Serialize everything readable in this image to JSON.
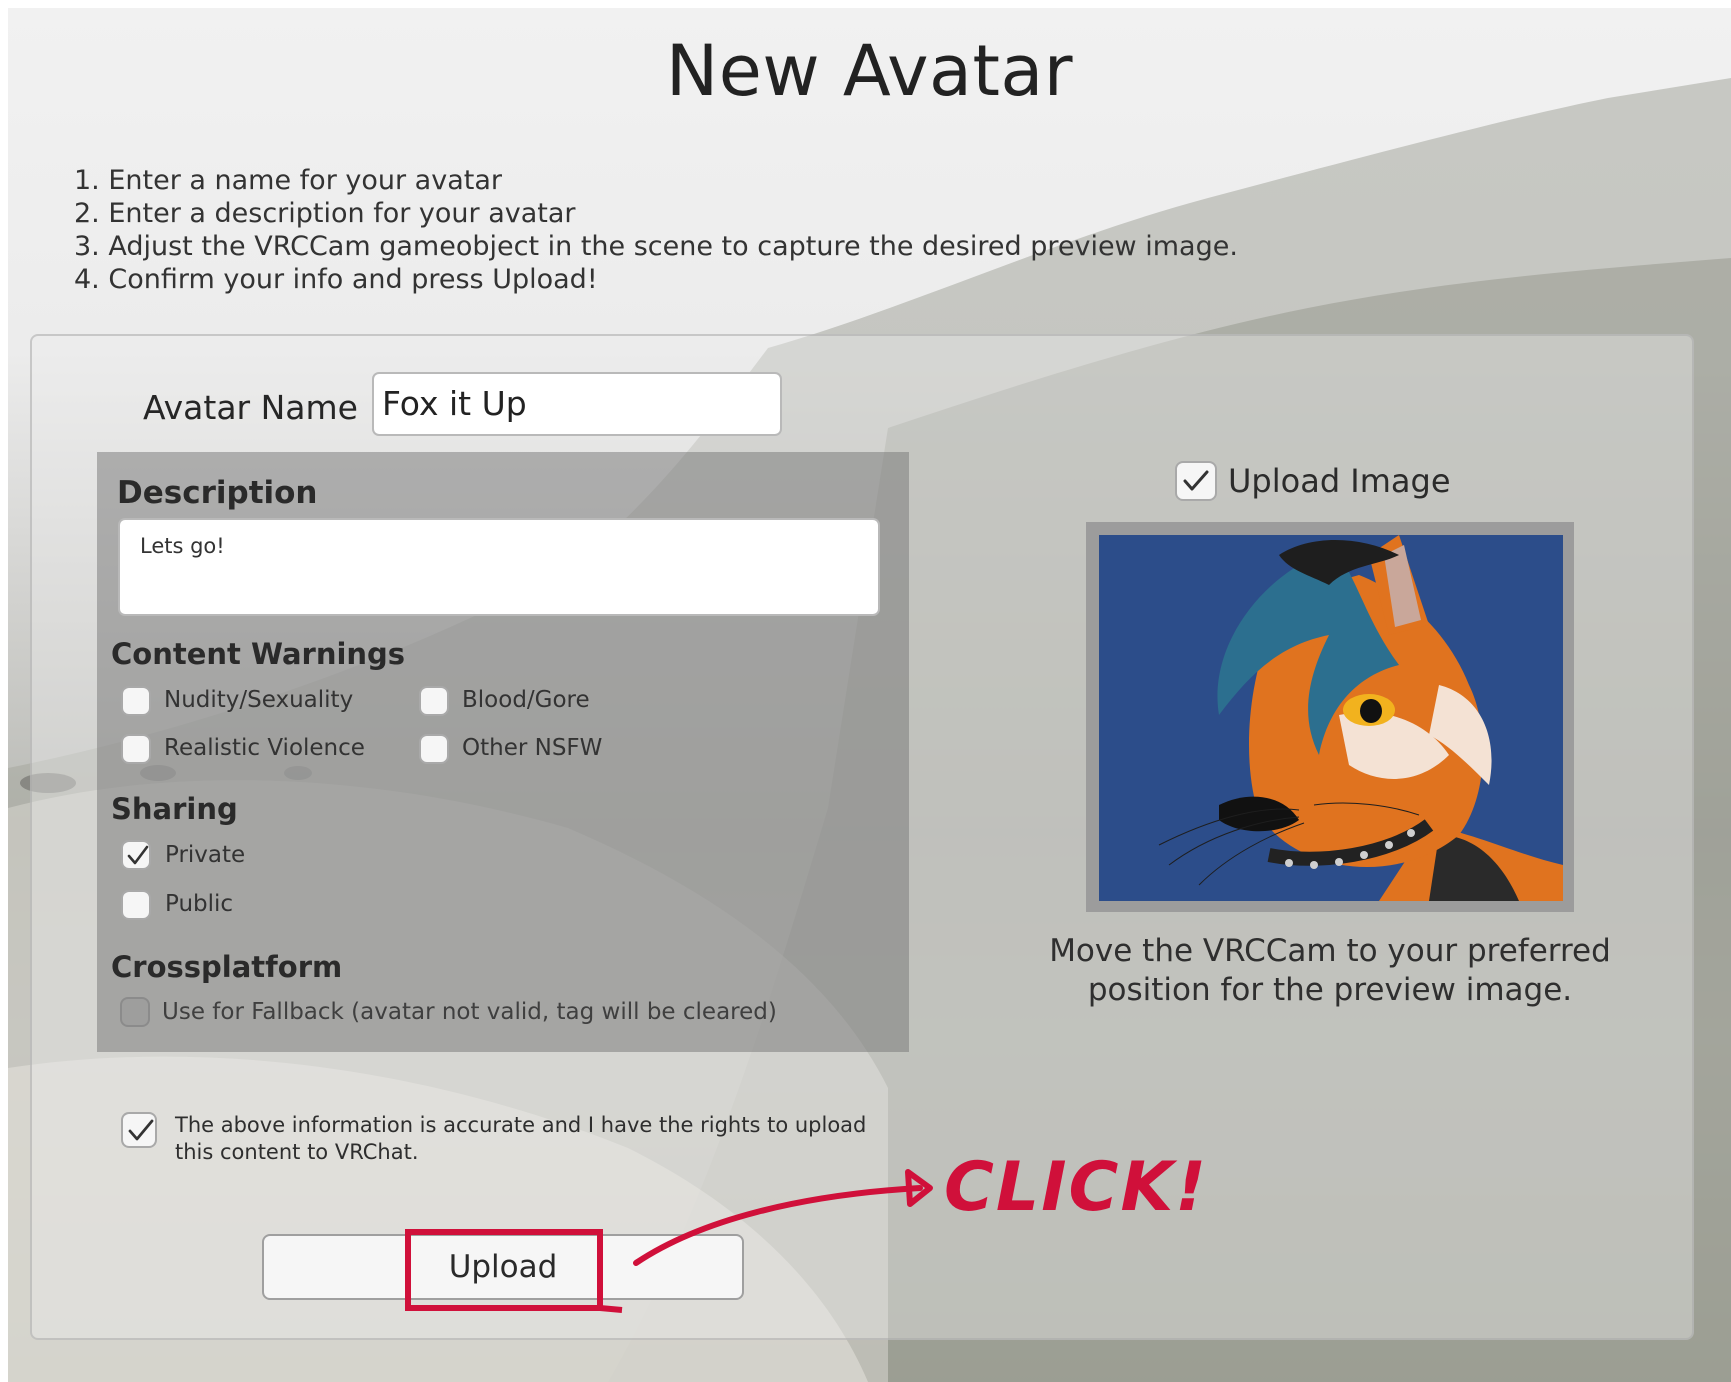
{
  "title": "New Avatar",
  "steps": [
    "1. Enter a name for your avatar",
    "2. Enter a description for your avatar",
    "3. Adjust the VRCCam gameobject in the scene to capture the desired preview image.",
    "4. Confirm your info and press Upload!"
  ],
  "avatar_name": {
    "label": "Avatar Name",
    "value": "Fox it Up"
  },
  "description": {
    "heading": "Description",
    "value": "Lets go!"
  },
  "content_warnings": {
    "heading": "Content Warnings",
    "items": [
      {
        "label": "Nudity/Sexuality",
        "checked": false
      },
      {
        "label": "Blood/Gore",
        "checked": false
      },
      {
        "label": "Realistic Violence",
        "checked": false
      },
      {
        "label": "Other NSFW",
        "checked": false
      }
    ]
  },
  "sharing": {
    "heading": "Sharing",
    "items": [
      {
        "label": "Private",
        "checked": true
      },
      {
        "label": "Public",
        "checked": false
      }
    ]
  },
  "crossplatform": {
    "heading": "Crossplatform",
    "fallback_label": "Use for Fallback (avatar not valid, tag will be cleared)",
    "checked": false
  },
  "upload_image": {
    "label": "Upload Image",
    "checked": true
  },
  "preview_caption": "Move the VRCCam to your preferred position for the preview image.",
  "agreement": {
    "text": "The above information is accurate and I have the rights to upload this content to VRChat.",
    "checked": true
  },
  "upload_button": {
    "label": "Upload"
  },
  "annotation": {
    "text": "CLICK!",
    "color": "#d0103a"
  },
  "colors": {
    "preview_bg": "#2c4d8a",
    "fox_orange": "#e0731f"
  }
}
